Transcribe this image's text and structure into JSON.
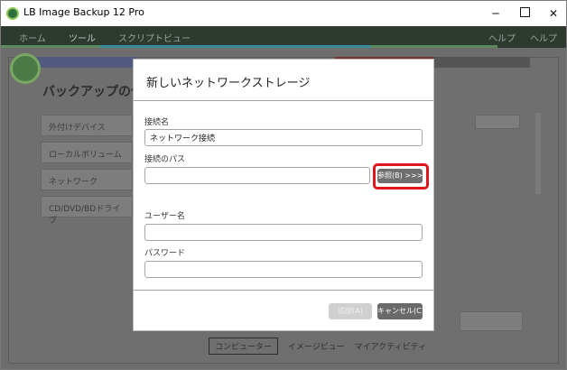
{
  "window": {
    "title": "LB Image Backup 12 Pro",
    "minimize_glyph": "─",
    "close_glyph": "✕"
  },
  "background": {
    "menu": {
      "home": "ホーム",
      "tools": "ツール",
      "script_view": "スクリプトビュー",
      "help1": "ヘルプ",
      "help2": "ヘルプ"
    },
    "heading": "バックアップの作",
    "list_items": [
      "外付けデバイス",
      "ローカルボリューム",
      "ネットワーク",
      "CD/DVD/BDドライブ"
    ],
    "bottom_tabs": [
      "コンピューター",
      "イメージビュー",
      "マイアクティビティ"
    ]
  },
  "dialog": {
    "title": "新しいネットワークストレージ",
    "connection_name_label": "接続名",
    "connection_name_value": "ネットワーク接続",
    "connection_path_label": "接続のパス",
    "connection_path_value": "",
    "browse_label": "参照(B) >>>",
    "username_label": "ユーザー名",
    "username_value": "",
    "password_label": "パスワード",
    "password_value": "",
    "add_label": "追加(A)",
    "cancel_label": "キャンセル(C)"
  },
  "colors": {
    "highlight": "#e0161e",
    "button_dark": "#6a6a6a",
    "button_disabled": "#d0d0d0"
  }
}
